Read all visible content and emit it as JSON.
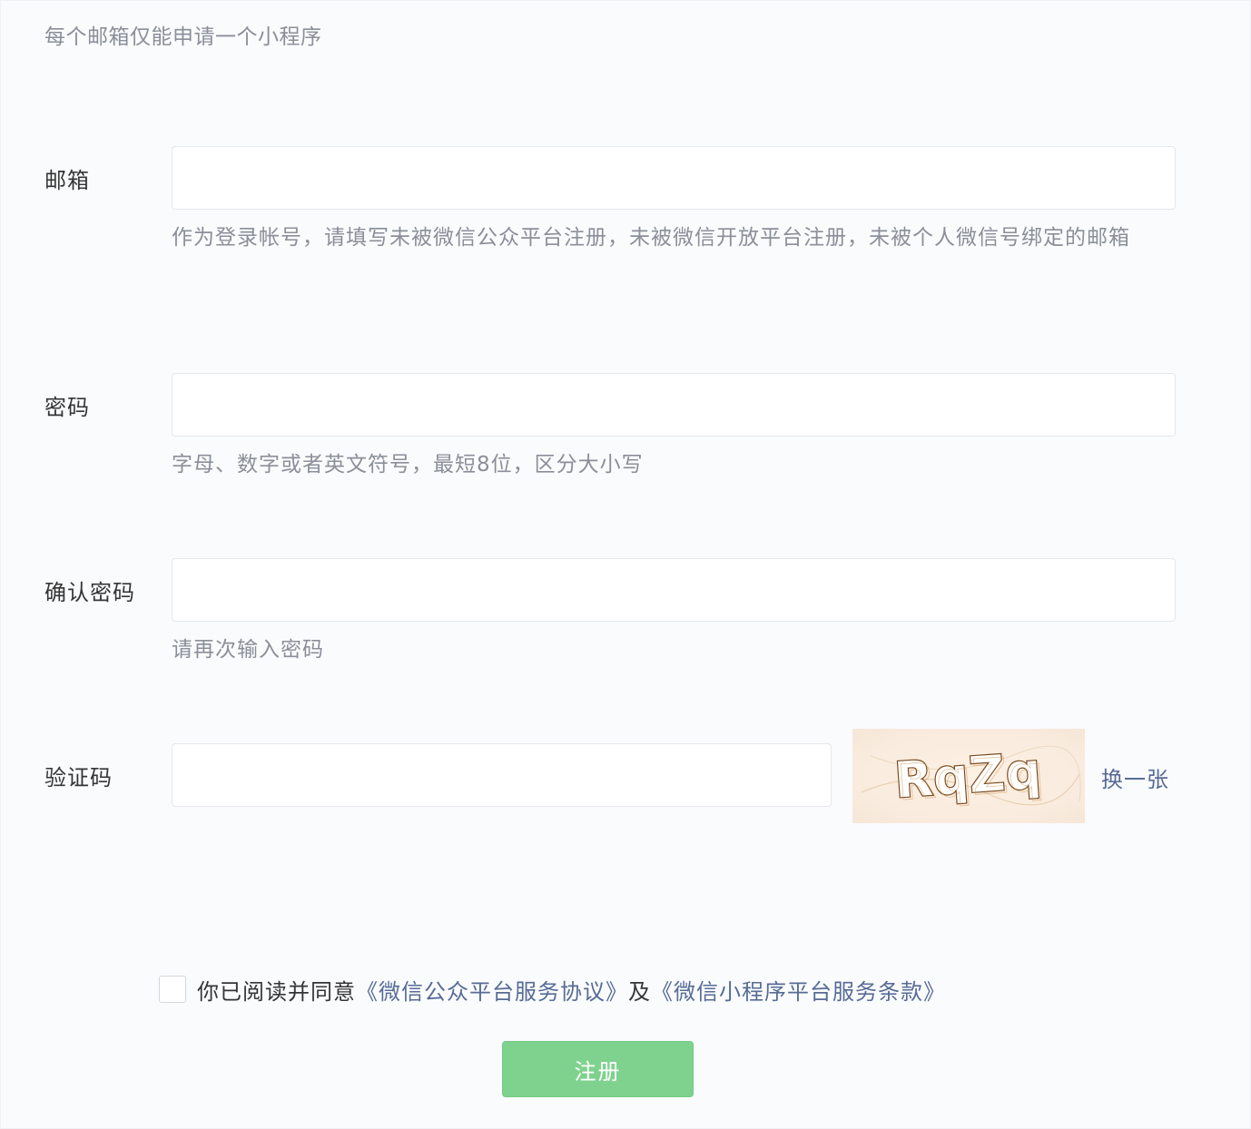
{
  "form": {
    "top_tip": "每个邮箱仅能申请一个小程序",
    "email": {
      "label": "邮箱",
      "value": "",
      "hint": "作为登录帐号，请填写未被微信公众平台注册，未被微信开放平台注册，未被个人微信号绑定的邮箱"
    },
    "password": {
      "label": "密码",
      "value": "",
      "hint": "字母、数字或者英文符号，最短8位，区分大小写"
    },
    "confirm_password": {
      "label": "确认密码",
      "value": "",
      "hint": "请再次输入密码"
    },
    "captcha": {
      "label": "验证码",
      "value": "",
      "image_text": "RqZq",
      "refresh_label": "换一张"
    },
    "agreement": {
      "checked": false,
      "prefix": "你已阅读并同意",
      "link1": "《微信公众平台服务协议》",
      "conjunction": "及",
      "link2": "《微信小程序平台服务条款》"
    },
    "submit_label": "注册"
  },
  "colors": {
    "accent_green": "#7fd28e",
    "link_blue": "#576b95",
    "hint_gray": "#8a8f99"
  }
}
